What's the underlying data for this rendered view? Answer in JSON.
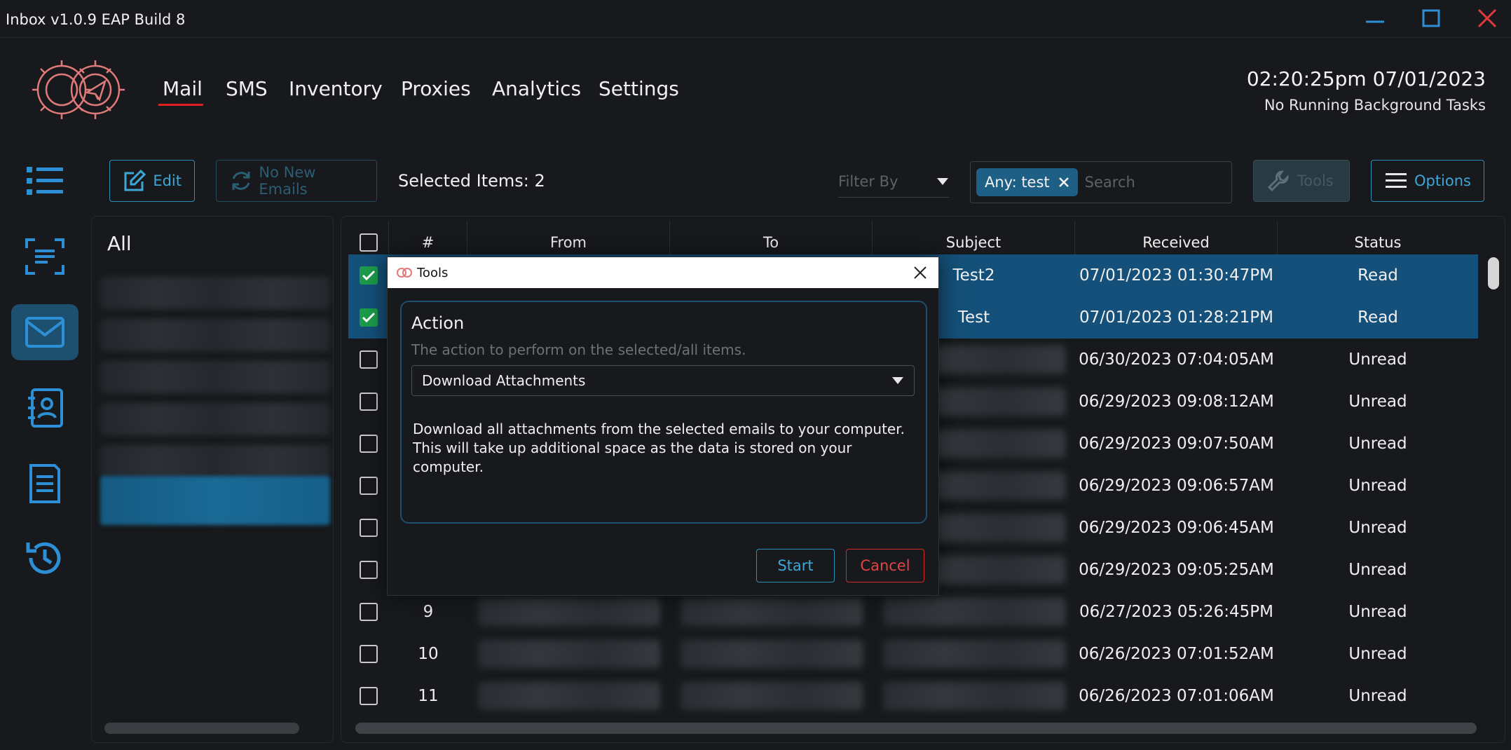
{
  "window": {
    "title": "Inbox v1.0.9 EAP Build 8"
  },
  "nav": {
    "tabs": [
      "Mail",
      "SMS",
      "Inventory",
      "Proxies",
      "Analytics",
      "Settings"
    ],
    "active": "Mail"
  },
  "header": {
    "clock": "02:20:25pm 07/01/2023",
    "status": "No Running Background Tasks"
  },
  "colors": {
    "accent": "#3ca7d6",
    "selected_row": "#145079",
    "danger": "#e04545",
    "active_tab_underline": "#e02020"
  },
  "toolbar": {
    "edit_label": "Edit",
    "refresh_label": "No New Emails",
    "selected_items": "Selected Items: 2",
    "filter_placeholder": "Filter By",
    "search_chip": "Any: test",
    "search_placeholder": "Search",
    "tools_label": "Tools",
    "options_label": "Options"
  },
  "folders": {
    "title": "All"
  },
  "table": {
    "columns": [
      "#",
      "From",
      "To",
      "Subject",
      "Received",
      "Status"
    ],
    "rows": [
      {
        "num": "",
        "subject": "Test2",
        "received": "07/01/2023 01:30:47PM",
        "status": "Read",
        "checked": true
      },
      {
        "num": "",
        "subject": "Test",
        "received": "07/01/2023 01:28:21PM",
        "status": "Read",
        "checked": true
      },
      {
        "num": "",
        "subject": "",
        "received": "06/30/2023 07:04:05AM",
        "status": "Unread",
        "checked": false
      },
      {
        "num": "",
        "subject": "",
        "received": "06/29/2023 09:08:12AM",
        "status": "Unread",
        "checked": false
      },
      {
        "num": "",
        "subject": "",
        "received": "06/29/2023 09:07:50AM",
        "status": "Unread",
        "checked": false
      },
      {
        "num": "",
        "subject": "",
        "received": "06/29/2023 09:06:57AM",
        "status": "Unread",
        "checked": false
      },
      {
        "num": "",
        "subject": "",
        "received": "06/29/2023 09:06:45AM",
        "status": "Unread",
        "checked": false
      },
      {
        "num": "",
        "subject": "",
        "received": "06/29/2023 09:05:25AM",
        "status": "Unread",
        "checked": false
      },
      {
        "num": "9",
        "subject": "",
        "received": "06/27/2023 05:26:45PM",
        "status": "Unread",
        "checked": false
      },
      {
        "num": "10",
        "subject": "",
        "received": "06/26/2023 07:01:52AM",
        "status": "Unread",
        "checked": false
      },
      {
        "num": "11",
        "subject": "",
        "received": "06/26/2023 07:01:06AM",
        "status": "Unread",
        "checked": false
      }
    ]
  },
  "dialog": {
    "title": "Tools",
    "action_label": "Action",
    "action_help": "The action to perform on the selected/all items.",
    "action_value": "Download Attachments",
    "description": "Download all attachments from the selected emails to your computer. This will take up additional space as the data is stored on your computer.",
    "start_label": "Start",
    "cancel_label": "Cancel"
  },
  "icons": [
    "minimize-icon",
    "maximize-icon",
    "close-icon",
    "logo-gear-plane",
    "list-icon",
    "scan-text-icon",
    "mail-icon",
    "contacts-book-icon",
    "document-icon",
    "history-icon",
    "edit-icon",
    "refresh-icon",
    "wrench-icon",
    "hamburger-icon",
    "chevron-down-icon",
    "check-icon"
  ]
}
